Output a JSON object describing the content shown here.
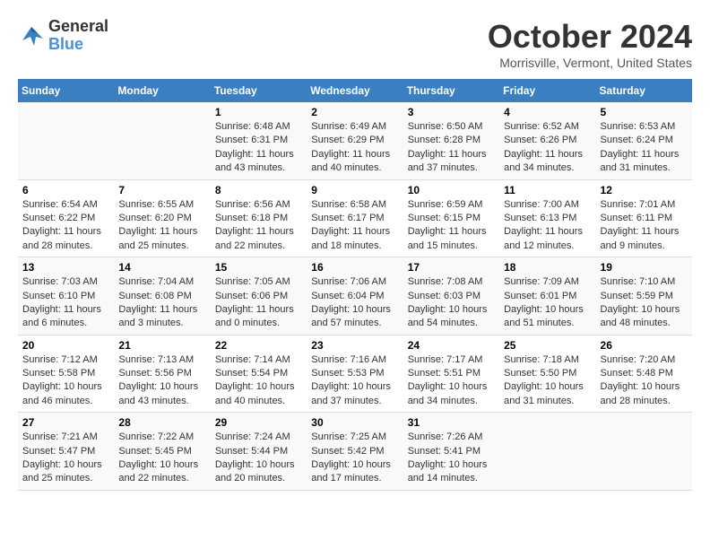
{
  "header": {
    "logo_line1": "General",
    "logo_line2": "Blue",
    "month": "October 2024",
    "location": "Morrisville, Vermont, United States"
  },
  "weekdays": [
    "Sunday",
    "Monday",
    "Tuesday",
    "Wednesday",
    "Thursday",
    "Friday",
    "Saturday"
  ],
  "weeks": [
    [
      {
        "day": "",
        "info": ""
      },
      {
        "day": "",
        "info": ""
      },
      {
        "day": "1",
        "info": "Sunrise: 6:48 AM\nSunset: 6:31 PM\nDaylight: 11 hours and 43 minutes."
      },
      {
        "day": "2",
        "info": "Sunrise: 6:49 AM\nSunset: 6:29 PM\nDaylight: 11 hours and 40 minutes."
      },
      {
        "day": "3",
        "info": "Sunrise: 6:50 AM\nSunset: 6:28 PM\nDaylight: 11 hours and 37 minutes."
      },
      {
        "day": "4",
        "info": "Sunrise: 6:52 AM\nSunset: 6:26 PM\nDaylight: 11 hours and 34 minutes."
      },
      {
        "day": "5",
        "info": "Sunrise: 6:53 AM\nSunset: 6:24 PM\nDaylight: 11 hours and 31 minutes."
      }
    ],
    [
      {
        "day": "6",
        "info": "Sunrise: 6:54 AM\nSunset: 6:22 PM\nDaylight: 11 hours and 28 minutes."
      },
      {
        "day": "7",
        "info": "Sunrise: 6:55 AM\nSunset: 6:20 PM\nDaylight: 11 hours and 25 minutes."
      },
      {
        "day": "8",
        "info": "Sunrise: 6:56 AM\nSunset: 6:18 PM\nDaylight: 11 hours and 22 minutes."
      },
      {
        "day": "9",
        "info": "Sunrise: 6:58 AM\nSunset: 6:17 PM\nDaylight: 11 hours and 18 minutes."
      },
      {
        "day": "10",
        "info": "Sunrise: 6:59 AM\nSunset: 6:15 PM\nDaylight: 11 hours and 15 minutes."
      },
      {
        "day": "11",
        "info": "Sunrise: 7:00 AM\nSunset: 6:13 PM\nDaylight: 11 hours and 12 minutes."
      },
      {
        "day": "12",
        "info": "Sunrise: 7:01 AM\nSunset: 6:11 PM\nDaylight: 11 hours and 9 minutes."
      }
    ],
    [
      {
        "day": "13",
        "info": "Sunrise: 7:03 AM\nSunset: 6:10 PM\nDaylight: 11 hours and 6 minutes."
      },
      {
        "day": "14",
        "info": "Sunrise: 7:04 AM\nSunset: 6:08 PM\nDaylight: 11 hours and 3 minutes."
      },
      {
        "day": "15",
        "info": "Sunrise: 7:05 AM\nSunset: 6:06 PM\nDaylight: 11 hours and 0 minutes."
      },
      {
        "day": "16",
        "info": "Sunrise: 7:06 AM\nSunset: 6:04 PM\nDaylight: 10 hours and 57 minutes."
      },
      {
        "day": "17",
        "info": "Sunrise: 7:08 AM\nSunset: 6:03 PM\nDaylight: 10 hours and 54 minutes."
      },
      {
        "day": "18",
        "info": "Sunrise: 7:09 AM\nSunset: 6:01 PM\nDaylight: 10 hours and 51 minutes."
      },
      {
        "day": "19",
        "info": "Sunrise: 7:10 AM\nSunset: 5:59 PM\nDaylight: 10 hours and 48 minutes."
      }
    ],
    [
      {
        "day": "20",
        "info": "Sunrise: 7:12 AM\nSunset: 5:58 PM\nDaylight: 10 hours and 46 minutes."
      },
      {
        "day": "21",
        "info": "Sunrise: 7:13 AM\nSunset: 5:56 PM\nDaylight: 10 hours and 43 minutes."
      },
      {
        "day": "22",
        "info": "Sunrise: 7:14 AM\nSunset: 5:54 PM\nDaylight: 10 hours and 40 minutes."
      },
      {
        "day": "23",
        "info": "Sunrise: 7:16 AM\nSunset: 5:53 PM\nDaylight: 10 hours and 37 minutes."
      },
      {
        "day": "24",
        "info": "Sunrise: 7:17 AM\nSunset: 5:51 PM\nDaylight: 10 hours and 34 minutes."
      },
      {
        "day": "25",
        "info": "Sunrise: 7:18 AM\nSunset: 5:50 PM\nDaylight: 10 hours and 31 minutes."
      },
      {
        "day": "26",
        "info": "Sunrise: 7:20 AM\nSunset: 5:48 PM\nDaylight: 10 hours and 28 minutes."
      }
    ],
    [
      {
        "day": "27",
        "info": "Sunrise: 7:21 AM\nSunset: 5:47 PM\nDaylight: 10 hours and 25 minutes."
      },
      {
        "day": "28",
        "info": "Sunrise: 7:22 AM\nSunset: 5:45 PM\nDaylight: 10 hours and 22 minutes."
      },
      {
        "day": "29",
        "info": "Sunrise: 7:24 AM\nSunset: 5:44 PM\nDaylight: 10 hours and 20 minutes."
      },
      {
        "day": "30",
        "info": "Sunrise: 7:25 AM\nSunset: 5:42 PM\nDaylight: 10 hours and 17 minutes."
      },
      {
        "day": "31",
        "info": "Sunrise: 7:26 AM\nSunset: 5:41 PM\nDaylight: 10 hours and 14 minutes."
      },
      {
        "day": "",
        "info": ""
      },
      {
        "day": "",
        "info": ""
      }
    ]
  ]
}
